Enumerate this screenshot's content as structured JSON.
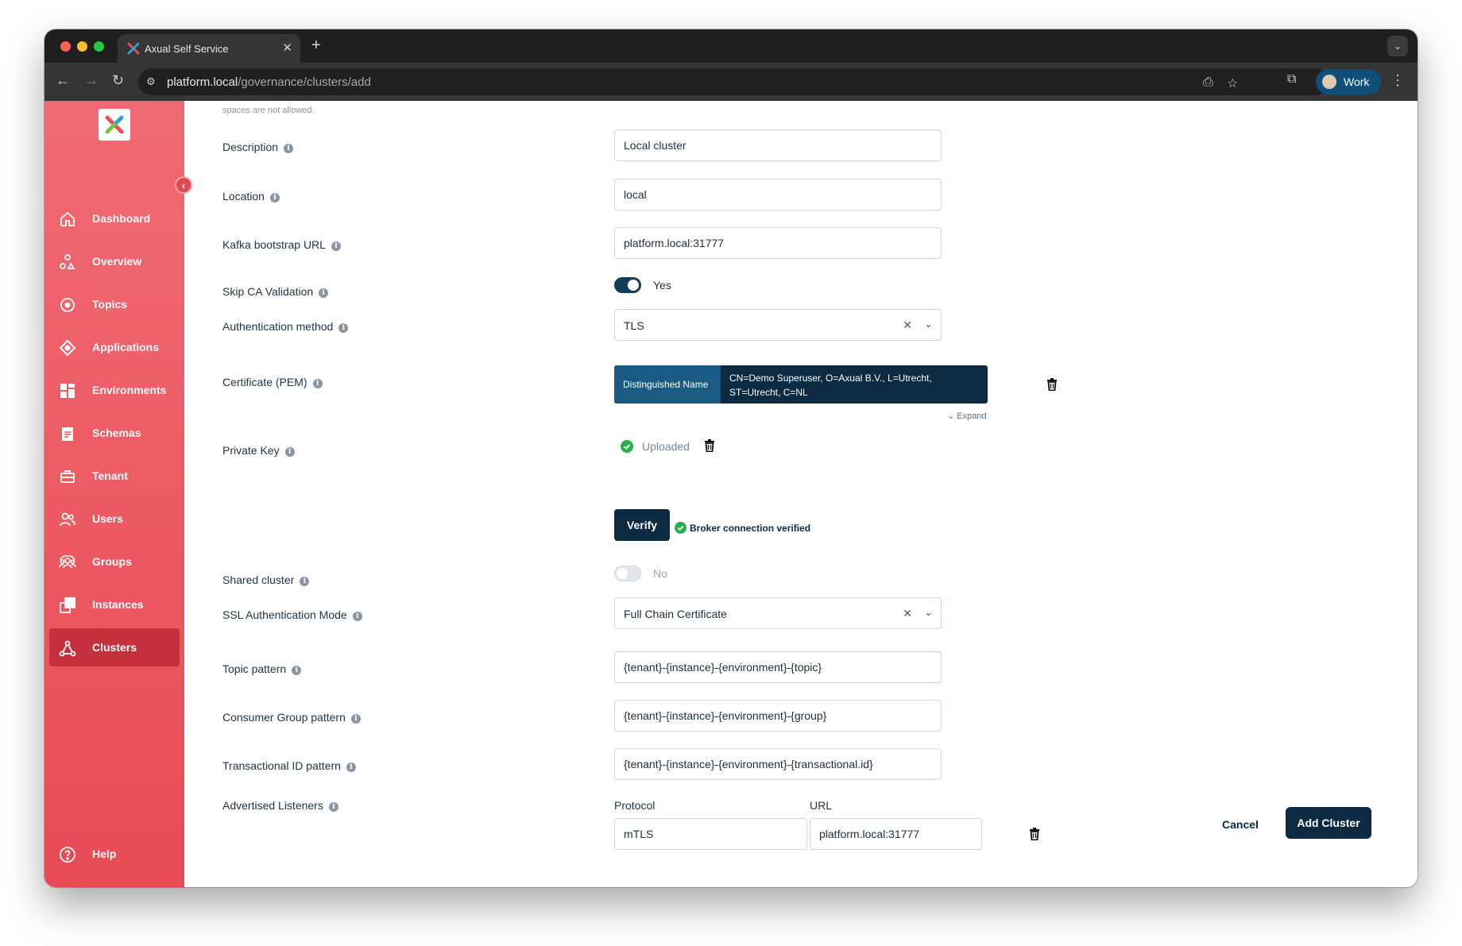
{
  "browser": {
    "tab_title": "Axual Self Service",
    "url_host": "platform.local",
    "url_path": "/governance/clusters/add",
    "profile_label": "Work",
    "new_tab_symbol": "+",
    "tab_close_symbol": "✕"
  },
  "sidebar": {
    "items": [
      {
        "label": "Dashboard",
        "icon": "home-icon"
      },
      {
        "label": "Overview",
        "icon": "overview-icon"
      },
      {
        "label": "Topics",
        "icon": "topics-icon"
      },
      {
        "label": "Applications",
        "icon": "applications-icon"
      },
      {
        "label": "Environments",
        "icon": "environments-icon"
      },
      {
        "label": "Schemas",
        "icon": "schemas-icon"
      },
      {
        "label": "Tenant",
        "icon": "tenant-icon"
      },
      {
        "label": "Users",
        "icon": "users-icon"
      },
      {
        "label": "Groups",
        "icon": "groups-icon"
      },
      {
        "label": "Instances",
        "icon": "instances-icon"
      },
      {
        "label": "Clusters",
        "icon": "clusters-icon",
        "active": true
      }
    ],
    "help_label": "Help",
    "accent_color": "#e84b55",
    "active_color": "#c4313d"
  },
  "form": {
    "name_hint": "spaces are not allowed.",
    "description": {
      "label": "Description",
      "value": "Local cluster"
    },
    "location": {
      "label": "Location",
      "value": "local"
    },
    "bootstrap": {
      "label": "Kafka bootstrap URL",
      "value": "platform.local:31777"
    },
    "skip_ca": {
      "label": "Skip CA Validation",
      "state_label": "Yes",
      "checked": true
    },
    "auth_method": {
      "label": "Authentication method",
      "value": "TLS"
    },
    "certificate": {
      "label": "Certificate (PEM)",
      "dn_key": "Distinguished Name",
      "dn_value": "CN=Demo Superuser, O=Axual B.V., L=Utrecht, ST=Utrecht, C=NL",
      "expand_label": "Expand"
    },
    "private_key": {
      "label": "Private Key",
      "status": "Uploaded"
    },
    "verify": {
      "button_label": "Verify",
      "status": "Broker connection verified"
    },
    "shared_cluster": {
      "label": "Shared cluster",
      "state_label": "No",
      "checked": false
    },
    "ssl_mode": {
      "label": "SSL Authentication Mode",
      "value": "Full Chain Certificate"
    },
    "topic_pattern": {
      "label": "Topic pattern",
      "value": "{tenant}-{instance}-{environment}-{topic}"
    },
    "consumer_pattern": {
      "label": "Consumer Group pattern",
      "value": "{tenant}-{instance}-{environment}-{group}"
    },
    "transactional_pattern": {
      "label": "Transactional ID pattern",
      "value": "{tenant}-{instance}-{environment}-{transactional.id}"
    },
    "listeners": {
      "label": "Advertised Listeners",
      "protocol_header": "Protocol",
      "url_header": "URL",
      "rows": [
        {
          "protocol": "mTLS",
          "url": "platform.local:31777"
        }
      ]
    }
  },
  "footer": {
    "cancel_label": "Cancel",
    "submit_label": "Add Cluster"
  }
}
